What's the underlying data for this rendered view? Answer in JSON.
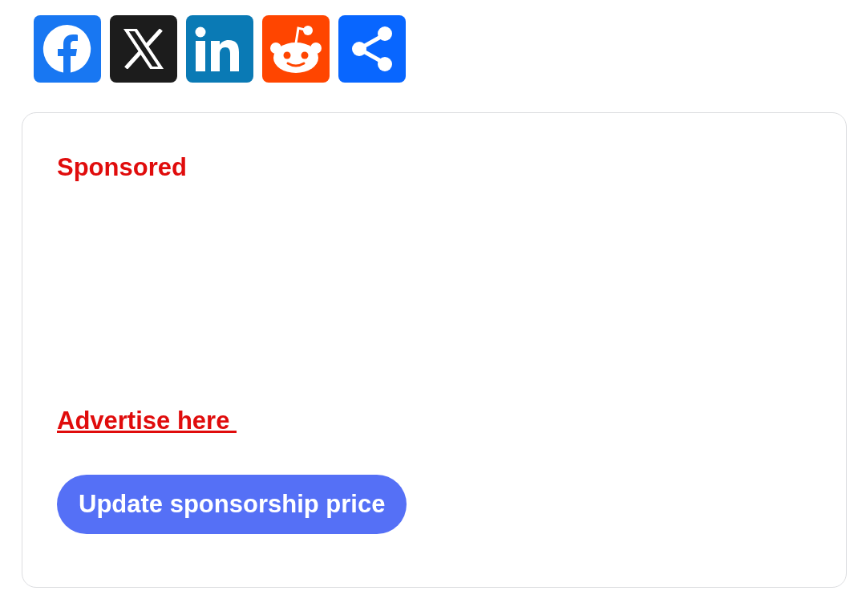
{
  "share_buttons": [
    {
      "kind": "facebook",
      "color": "#1877f2"
    },
    {
      "kind": "x",
      "color": "#1c1c1c"
    },
    {
      "kind": "linkedin",
      "color": "#0a7ab5"
    },
    {
      "kind": "reddit",
      "color": "#ff4500"
    },
    {
      "kind": "share",
      "color": "#0866ff"
    }
  ],
  "sponsor_card": {
    "heading": "Sponsored",
    "link": "Advertise here ",
    "button": "Update sponsorship price"
  }
}
